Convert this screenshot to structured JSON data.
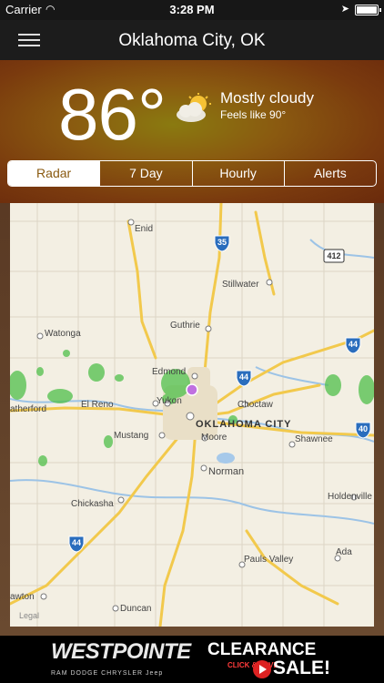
{
  "status_bar": {
    "carrier": "Carrier",
    "time": "3:28 PM"
  },
  "nav": {
    "title": "Oklahoma City, OK"
  },
  "current": {
    "temperature": "86°",
    "condition": "Mostly cloudy",
    "feels_like": "Feels like 90°",
    "icon": "partly-cloudy-icon"
  },
  "tabs": [
    {
      "label": "Radar",
      "active": true
    },
    {
      "label": "7 Day",
      "active": false
    },
    {
      "label": "Hourly",
      "active": false
    },
    {
      "label": "Alerts",
      "active": false
    }
  ],
  "map": {
    "cities": {
      "enid": "Enid",
      "stillwater": "Stillwater",
      "watonga": "Watonga",
      "guthrie": "Guthrie",
      "edmond": "Edmond",
      "el_reno": "El Reno",
      "yukon": "Yukon",
      "weatherford": "atherford",
      "choctaw": "Choctaw",
      "okc": "OKLAHOMA CITY",
      "mustang": "Mustang",
      "moore": "Moore",
      "shawnee": "Shawnee",
      "norman": "Norman",
      "holdenville": "Holdenville",
      "chickasha": "Chickasha",
      "pauls_valley": "Pauls Valley",
      "ada": "Ada",
      "lawton": "awton",
      "duncan": "Duncan"
    },
    "shields": {
      "i35": "35",
      "us412": "412",
      "i44_ne": "44",
      "i44_c": "44",
      "i40": "40",
      "i44_sw": "44"
    },
    "legal": "Legal"
  },
  "ad": {
    "brand": "WESTPOINTE",
    "headline": "CLEARANCE",
    "sale": "SALE!",
    "cta": "CLICK & SAVE",
    "makes": "RAM  DODGE  CHRYSLER  Jeep"
  }
}
